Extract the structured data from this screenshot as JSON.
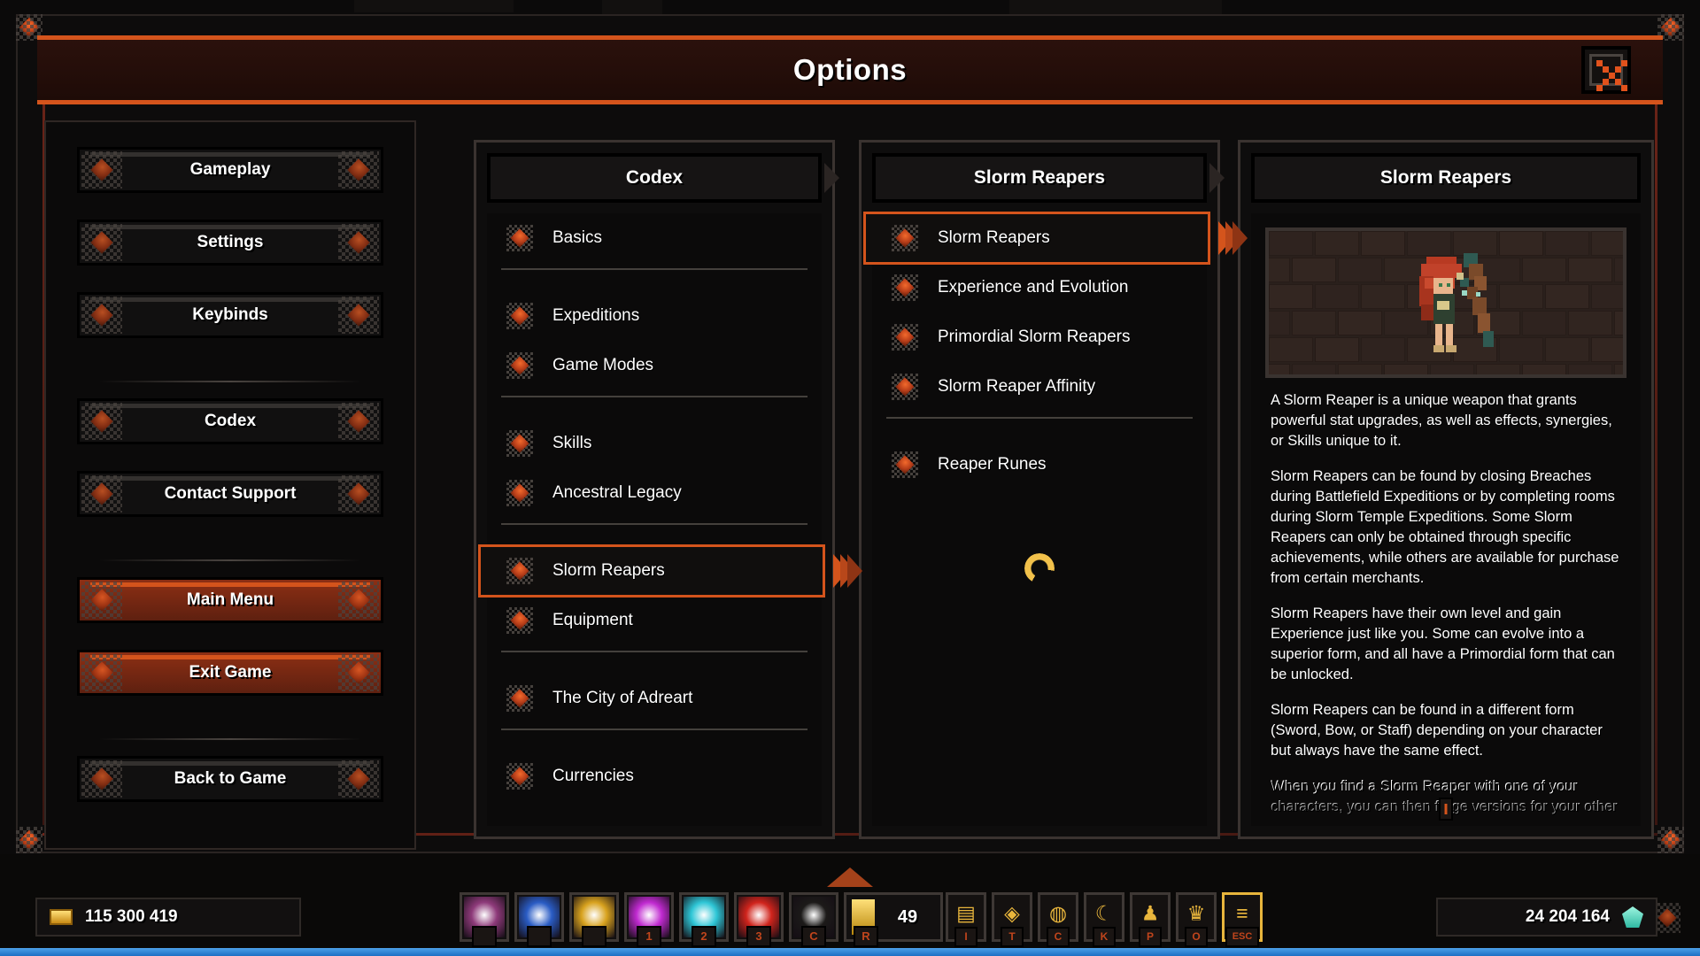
{
  "window": {
    "title": "Options",
    "close_icon": "close-x-icon"
  },
  "sidebar": {
    "groups": [
      {
        "items": [
          {
            "label": "Gameplay",
            "style": "normal"
          },
          {
            "label": "Settings",
            "style": "normal"
          },
          {
            "label": "Keybinds",
            "style": "normal"
          }
        ]
      },
      {
        "items": [
          {
            "label": "Codex",
            "style": "normal"
          },
          {
            "label": "Contact Support",
            "style": "normal"
          }
        ]
      },
      {
        "items": [
          {
            "label": "Main Menu",
            "style": "danger"
          },
          {
            "label": "Exit Game",
            "style": "danger"
          }
        ]
      },
      {
        "items": [
          {
            "label": "Back to Game",
            "style": "normal"
          }
        ]
      }
    ]
  },
  "columns": {
    "codex": {
      "header": "Codex",
      "entries": [
        {
          "type": "item",
          "label": "Basics",
          "selected": false
        },
        {
          "type": "divider"
        },
        {
          "type": "item",
          "label": "Expeditions",
          "selected": false
        },
        {
          "type": "item",
          "label": "Game Modes",
          "selected": false
        },
        {
          "type": "divider"
        },
        {
          "type": "item",
          "label": "Skills",
          "selected": false
        },
        {
          "type": "item",
          "label": "Ancestral Legacy",
          "selected": false
        },
        {
          "type": "divider"
        },
        {
          "type": "item",
          "label": "Slorm Reapers",
          "selected": true
        },
        {
          "type": "item",
          "label": "Equipment",
          "selected": false
        },
        {
          "type": "divider"
        },
        {
          "type": "item",
          "label": "The City of Adreart",
          "selected": false
        },
        {
          "type": "divider"
        },
        {
          "type": "item",
          "label": "Currencies",
          "selected": false
        }
      ]
    },
    "reapers": {
      "header": "Slorm Reapers",
      "entries": [
        {
          "type": "item",
          "label": "Slorm Reapers",
          "selected": true
        },
        {
          "type": "item",
          "label": "Experience and Evolution",
          "selected": false
        },
        {
          "type": "item",
          "label": "Primordial Slorm Reapers",
          "selected": false
        },
        {
          "type": "item",
          "label": "Slorm Reaper Affinity",
          "selected": false
        },
        {
          "type": "divider"
        },
        {
          "type": "item",
          "label": "Reaper Runes",
          "selected": false
        }
      ],
      "loading_icon": "crescent-moon-spinner"
    },
    "detail": {
      "header": "Slorm Reapers",
      "image_alt": "slorm-reaper-character-art",
      "paragraphs": [
        {
          "text": "A Slorm Reaper is a unique weapon that grants powerful stat upgrades, as well as effects, synergies, or Skills unique to it.",
          "faded": false
        },
        {
          "text": "Slorm Reapers can be found by closing Breaches during Battlefield Expeditions or by completing rooms during Slorm Temple Expeditions. Some Slorm Reapers can only be obtained through specific achievements, while others are available for purchase from certain merchants.",
          "faded": false
        },
        {
          "text": "Slorm Reapers have their own level and gain Experience just like you. Some can evolve into a superior form, and all have a Primordial form that can be unlocked.",
          "faded": false
        },
        {
          "text": "Slorm Reapers can be found in a different form (Sword, Bow, or Staff) depending on your character but always have the same effect.",
          "faded": false
        },
        {
          "text": "When you find a Slorm Reaper with one of your characters, you can then forge versions for your other characters by visiting Cory Ironbender.",
          "faded": true
        }
      ]
    }
  },
  "hud": {
    "gold": {
      "icon": "gold-bar-icon",
      "value": "115 300 419"
    },
    "gem": {
      "icon": "teal-gem-icon",
      "value": "24 204 164"
    },
    "skill_slots": [
      {
        "icon": "crescent-slash-skill-icon",
        "key": "",
        "color": "#8e3a7a"
      },
      {
        "icon": "blue-blade-skill-icon",
        "key": "",
        "color": "#2a5cc4"
      },
      {
        "icon": "golden-wings-support-icon",
        "key": "",
        "color": "#d8a21e"
      },
      {
        "icon": "purple-orb-skill-icon",
        "key": "1",
        "color": "#c02ad0"
      },
      {
        "icon": "cyan-ring-skill-icon",
        "key": "2",
        "color": "#2ec6d6"
      },
      {
        "icon": "red-figure-skill-icon",
        "key": "3",
        "color": "#d0241c"
      },
      {
        "icon": "empty-slot-icon",
        "key": "C",
        "color": "#1c1a19"
      }
    ],
    "potion": {
      "icon": "health-potion-icon",
      "count": "49",
      "key": "R"
    },
    "menu_slots": [
      {
        "icon": "inventory-bag-icon",
        "key": "I"
      },
      {
        "icon": "skill-tree-icon",
        "key": "T"
      },
      {
        "icon": "character-stats-icon",
        "key": "C"
      },
      {
        "icon": "reaper-moon-icon",
        "key": "K"
      },
      {
        "icon": "profile-icon",
        "key": "P"
      },
      {
        "icon": "trophy-icon",
        "key": "O"
      },
      {
        "icon": "menu-lines-icon",
        "key": "ESC"
      }
    ],
    "xp_percent": 100,
    "arrow_icon": "hud-expand-arrow-icon"
  }
}
